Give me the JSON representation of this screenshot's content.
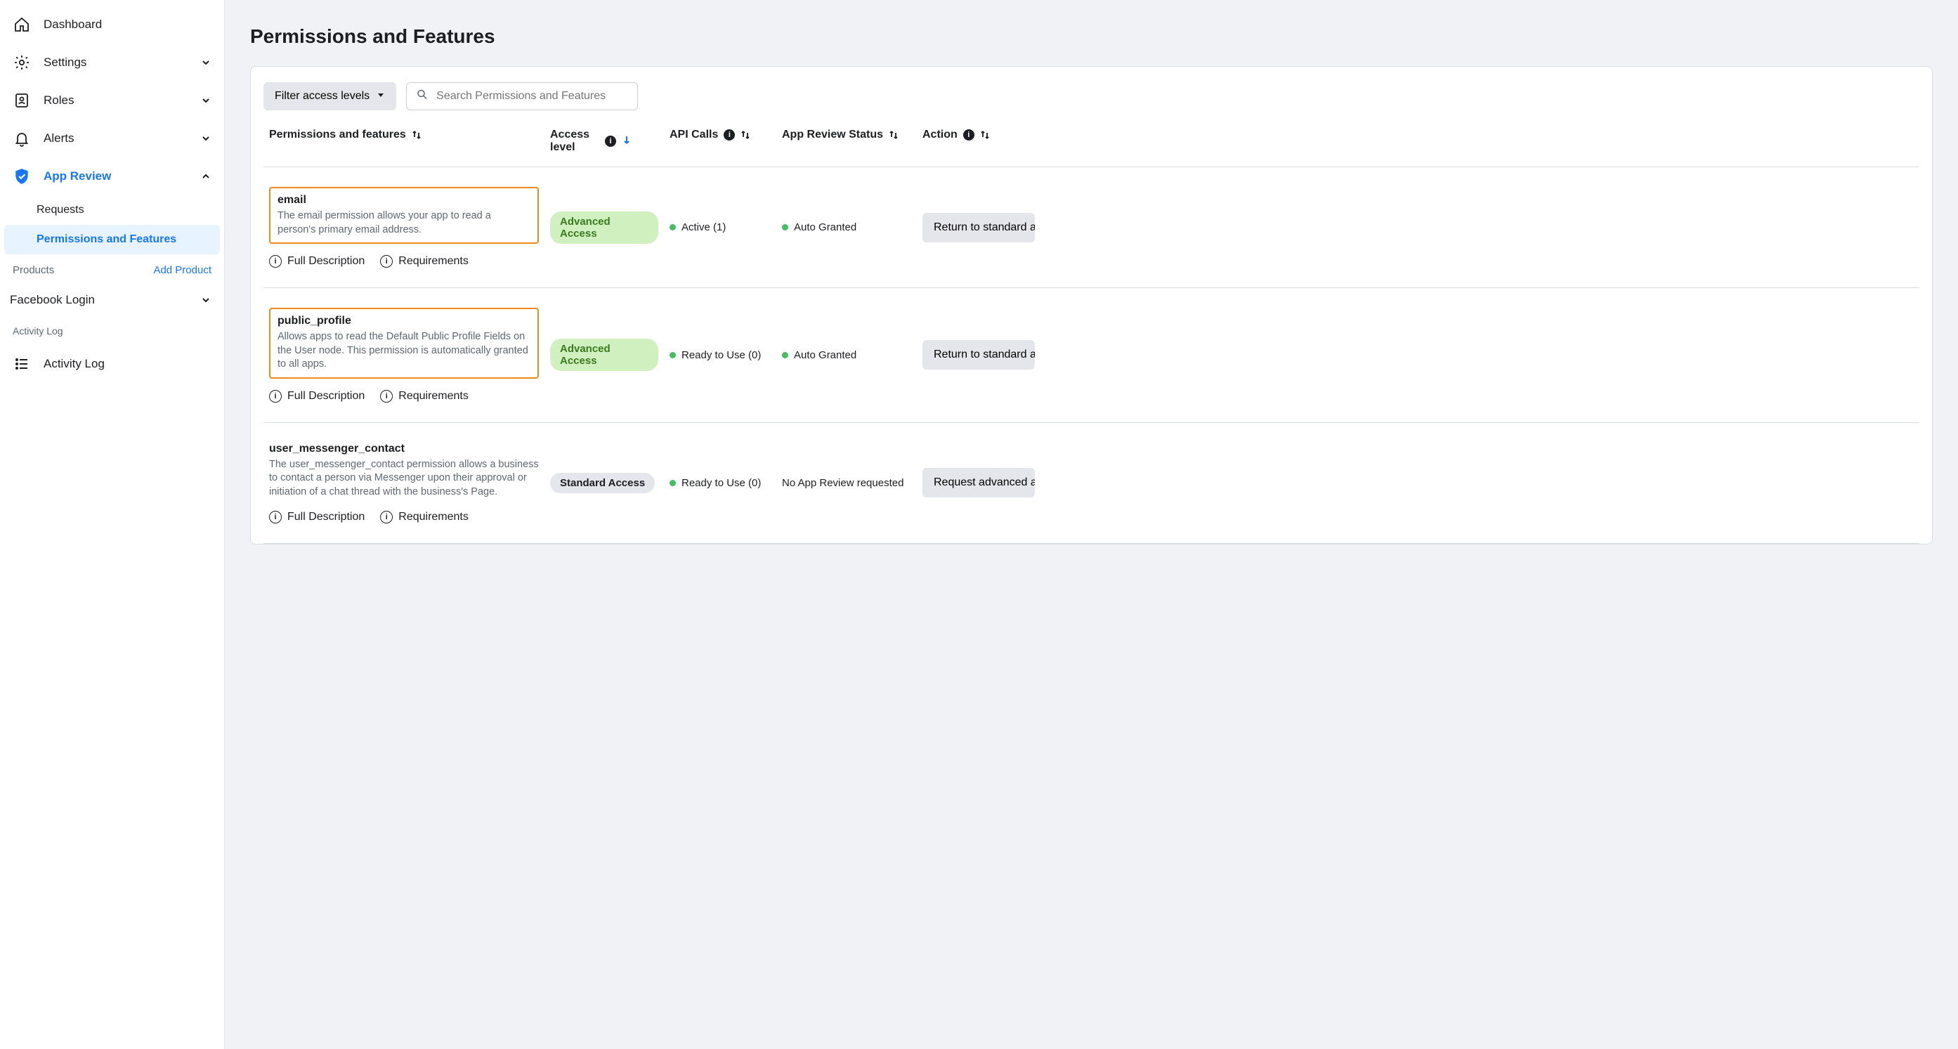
{
  "sidebar": {
    "dashboard": "Dashboard",
    "settings": "Settings",
    "roles": "Roles",
    "alerts": "Alerts",
    "app_review": "App Review",
    "app_review_sub": {
      "requests": "Requests",
      "perms": "Permissions and Features"
    },
    "products_label": "Products",
    "add_product": "Add Product",
    "facebook_login": "Facebook Login",
    "activity_log_label": "Activity Log",
    "activity_log": "Activity Log"
  },
  "page": {
    "title": "Permissions and Features",
    "filter_label": "Filter access levels",
    "search_placeholder": "Search Permissions and Features"
  },
  "columns": {
    "perms": "Permissions and features",
    "access": "Access level",
    "api": "API Calls",
    "review": "App Review Status",
    "action": "Action"
  },
  "links": {
    "full_desc": "Full Description",
    "reqs": "Requirements"
  },
  "rows": [
    {
      "name": "email",
      "desc": "The email permission allows your app to read a person's primary email address.",
      "highlighted": true,
      "access_badge": "Advanced Access",
      "access_style": "green",
      "api_status": "Active (1)",
      "api_dot": true,
      "review_status": "Auto Granted",
      "review_dot": true,
      "action_label": "Return to standard access"
    },
    {
      "name": "public_profile",
      "desc": "Allows apps to read the Default Public Profile Fields on the User node. This permission is automatically granted to all apps.",
      "highlighted": true,
      "access_badge": "Advanced Access",
      "access_style": "green",
      "api_status": "Ready to Use (0)",
      "api_dot": true,
      "review_status": "Auto Granted",
      "review_dot": true,
      "action_label": "Return to standard access"
    },
    {
      "name": "user_messenger_contact",
      "desc": "The user_messenger_contact permission allows a business to contact a person via Messenger upon their approval or initiation of a chat thread with the business's Page.",
      "highlighted": false,
      "access_badge": "Standard Access",
      "access_style": "grey",
      "api_status": "Ready to Use (0)",
      "api_dot": true,
      "review_status": "No App Review requested",
      "review_dot": false,
      "action_label": "Request advanced access"
    }
  ]
}
